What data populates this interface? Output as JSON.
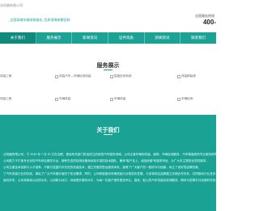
{
  "header": {
    "site_subtitle": "业机器有限公司",
    "tagline": "_全国高端车辆改装服务_优质保障按需定制",
    "hotline_label": "全国服务热线",
    "hotline_number": "400-"
  },
  "nav": {
    "items": [
      "关于我们",
      "服务展示",
      "新闻资讯",
      "证件资质",
      "新闻资讯",
      "联系我们"
    ]
  },
  "services": {
    "title": "服务展示",
    "items": [
      "改装工程",
      "改装汽车—车辆检测改装",
      "智能检测系统",
      "改装精装修",
      "改装工程",
      "车辆改装",
      "车辆改装",
      "车辆检测"
    ]
  },
  "about": {
    "title": "关于我们",
    "paragraphs": [
      "业机器有限公司，于 2015 年 7 月 20 日在合肥，是经有关部门批准成立的新型汽车服务领域，公司主营车辆的改装、维修、车辆检测服务、汽车精装修的专业服务机构。",
      "公司致力于打造专业化的汽车综合服务平台，拥有先进的检测设备和经验丰富的技术团队，秉承“客户至上、诚信经营”的服务宗旨，为广大车主提供优质的服务。",
      "公司注重技术创新与人才培养，不断引进国内外先进的改装技术，建立完善的售后服务体系，赢得了广大客户的一致好评与信赖，树立了良好的品牌形象。",
      "了汽车改装行业的标准，满足了广大汽车爱好者的个性化需求，同时，公司积极推动车辆改装行业规范化发展，与多家知名品牌建立长期合作关系，共同推动行业进步。",
      "面向未来，公司将继续以品质为本，以创新为动力，持续提升服务水平，为每一位客户提供更加专业、高效、贴心的汽车改装及检测服务，期待与您携手共创美好未来。"
    ]
  }
}
